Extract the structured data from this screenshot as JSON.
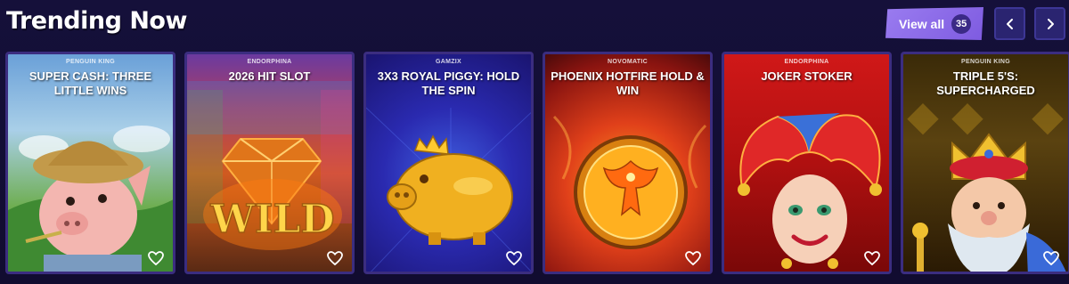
{
  "section": {
    "title": "Trending Now"
  },
  "view_all": {
    "label": "View all",
    "count": "35"
  },
  "nav": {
    "prev_icon": "chevron-left-icon",
    "next_icon": "chevron-right-icon"
  },
  "colors": {
    "accent": "#8b6cf0",
    "background": "#120d33",
    "nav_bg": "#2a2470"
  },
  "cards": [
    {
      "provider": "PENGUIN KING",
      "name": "SUPER CASH: THREE LITTLE WINS"
    },
    {
      "provider": "ENDORPHINA",
      "name": "2026 HIT SLOT"
    },
    {
      "provider": "GAMZIX",
      "name": "3X3 ROYAL PIGGY: HOLD THE SPIN"
    },
    {
      "provider": "NOVOMATIC",
      "name": "PHOENIX HOTFIRE HOLD & WIN"
    },
    {
      "provider": "ENDORPHINA",
      "name": "JOKER STOKER"
    },
    {
      "provider": "PENGUIN KING",
      "name": "TRIPLE 5'S: SUPERCHARGED"
    }
  ],
  "card_icons": {
    "favorite": "heart-icon"
  }
}
